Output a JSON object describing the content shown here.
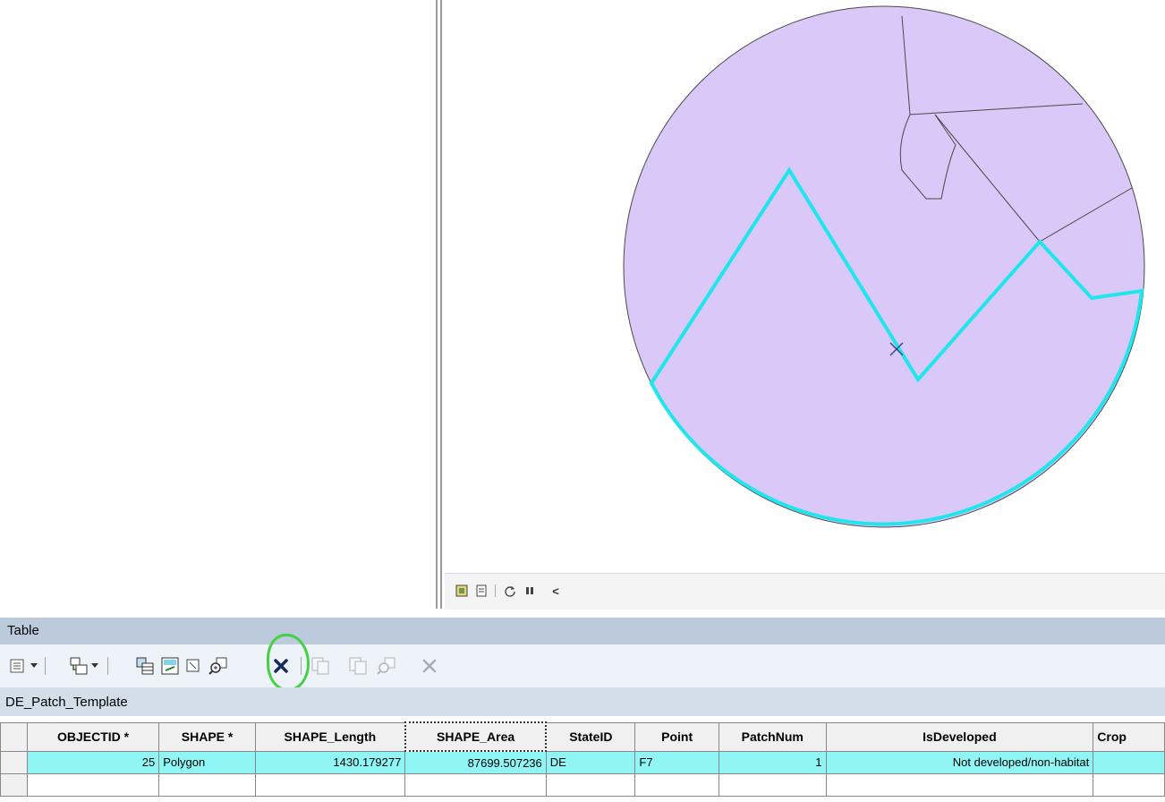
{
  "map": {
    "fill_color": "#d9c8f8",
    "outline_color": "#4a4a4a",
    "selection_color": "#1ee6ec",
    "statusbar": {
      "layout_view_icon": "layout-view-icon",
      "data_view_icon": "data-view-icon",
      "refresh_icon": "refresh-icon",
      "pause_icon": "pause-icon",
      "scroll_left_label": "<"
    }
  },
  "table_panel": {
    "title": "Table",
    "toolbar": {
      "icons": [
        "table-options-icon",
        "related-tables-icon",
        "select-by-attributes-icon",
        "switch-selection-icon",
        "clear-selection-icon",
        "zoom-to-selected-icon",
        "delete-selected-icon",
        "copy-selected-icon",
        "paste-icon",
        "zoom-icon",
        "delete-icon"
      ],
      "highlighted_icon": "delete-selected-icon"
    },
    "tab_name": "DE_Patch_Template",
    "columns": [
      "OBJECTID *",
      "SHAPE *",
      "SHAPE_Length",
      "SHAPE_Area",
      "StateID",
      "Point",
      "PatchNum",
      "IsDeveloped",
      "Crop"
    ],
    "sorted_column": "SHAPE_Area",
    "rows": [
      [
        "25",
        "Polygon",
        "1430.179277",
        "87699.507236",
        "DE",
        "F7",
        "1",
        "Not developed/non-habitat",
        ""
      ]
    ],
    "selected_row_color": "#8ff5f5"
  }
}
